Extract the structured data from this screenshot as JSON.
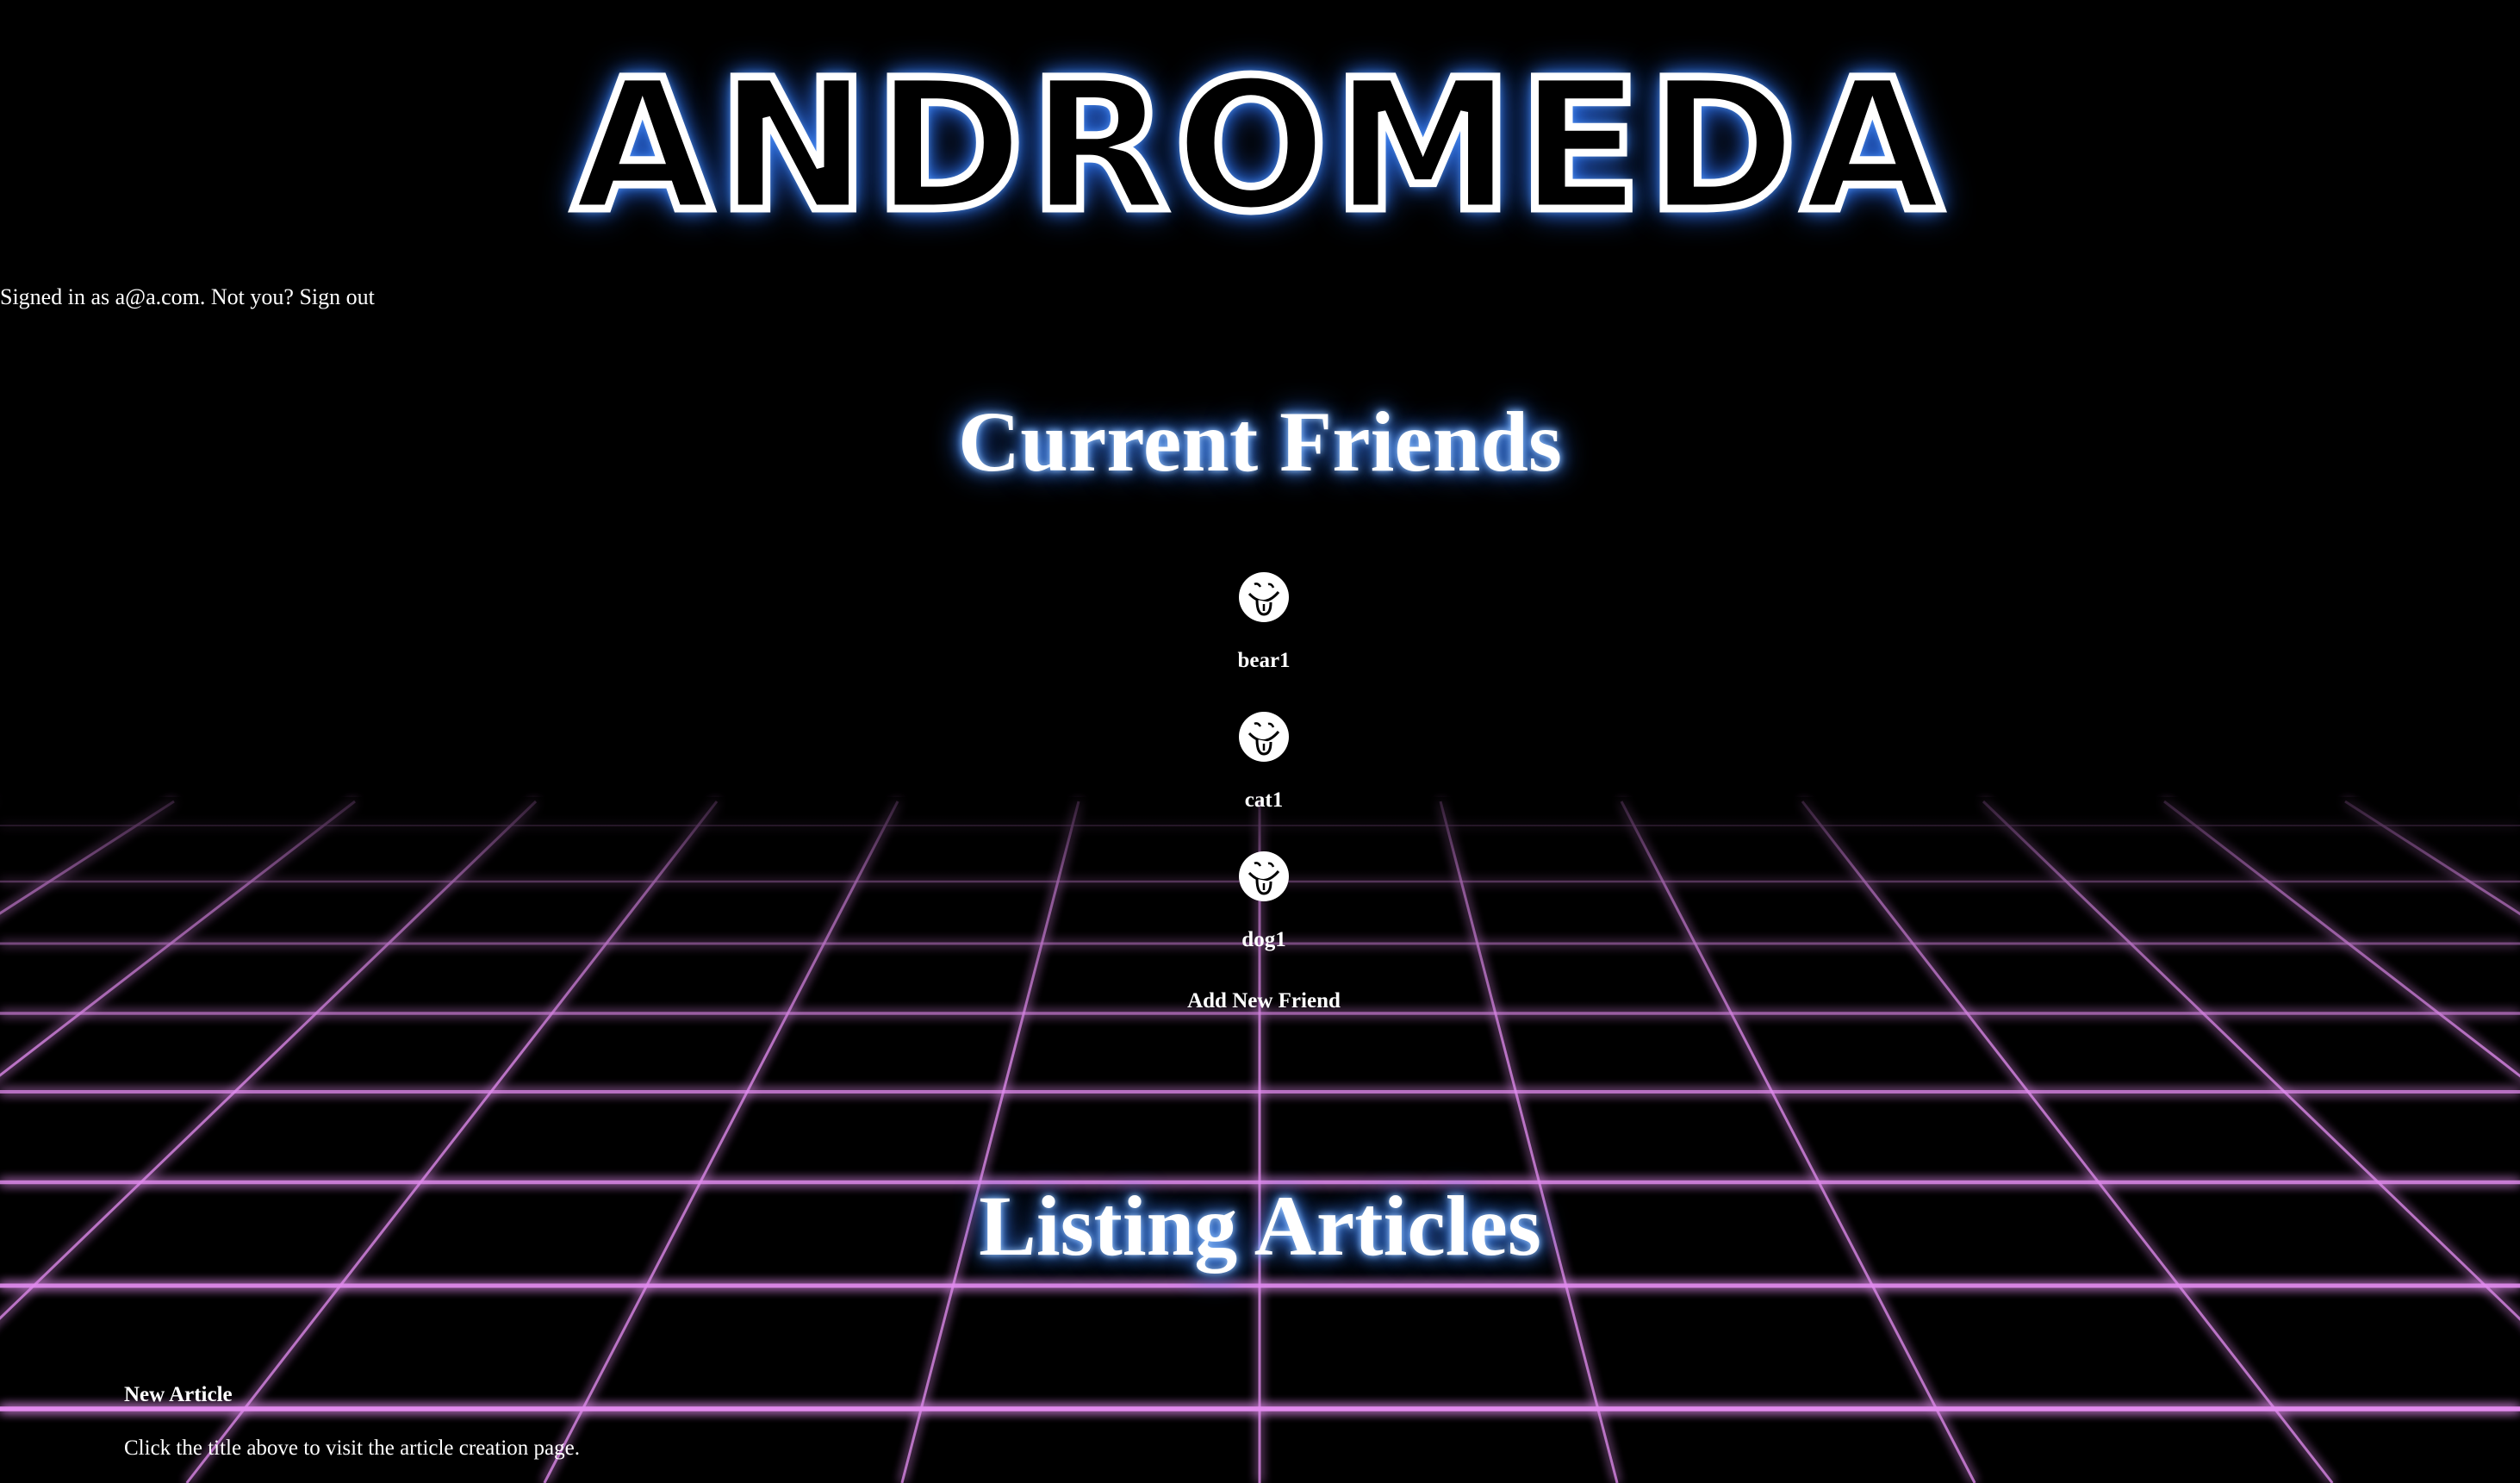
{
  "site": {
    "logo_text": "Andromeda"
  },
  "session": {
    "signed_in_prefix": "Signed in as ",
    "email": "a@a.com",
    "not_you": ". Not you? ",
    "sign_out_label": "Sign out"
  },
  "friends": {
    "title": "Current Friends",
    "items": [
      {
        "name": "bear1",
        "avatar_icon": "tongue-face-icon"
      },
      {
        "name": "cat1",
        "avatar_icon": "tongue-face-icon"
      },
      {
        "name": "dog1",
        "avatar_icon": "tongue-face-icon"
      }
    ],
    "add_label": "Add New Friend"
  },
  "articles": {
    "title": "Listing Articles",
    "new_article_label": "New Article",
    "hint": "Click the title above to visit the article creation page."
  },
  "theme": {
    "background": "#000000",
    "glow_blue": "#3d8bff",
    "grid_pink": "#e38cf0"
  }
}
